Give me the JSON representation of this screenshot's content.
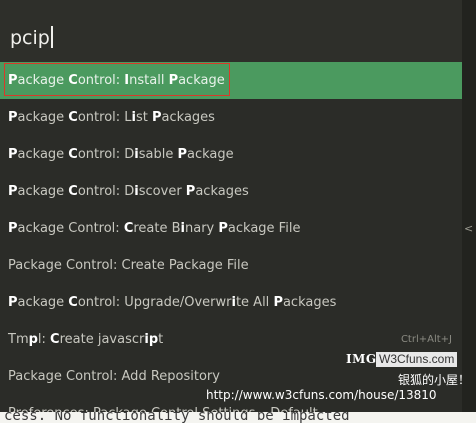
{
  "search": {
    "query": "pcip"
  },
  "items": [
    {
      "segments": [
        {
          "t": "P",
          "h": true
        },
        {
          "t": "ackage ",
          "h": false
        },
        {
          "t": "C",
          "h": true
        },
        {
          "t": "ontrol: ",
          "h": false
        },
        {
          "t": "I",
          "h": true
        },
        {
          "t": "nstall ",
          "h": false
        },
        {
          "t": "P",
          "h": true
        },
        {
          "t": "ackage",
          "h": false
        }
      ]
    },
    {
      "segments": [
        {
          "t": "P",
          "h": true
        },
        {
          "t": "ackage ",
          "h": false
        },
        {
          "t": "C",
          "h": true
        },
        {
          "t": "ontrol: L",
          "h": false
        },
        {
          "t": "i",
          "h": true
        },
        {
          "t": "st ",
          "h": false
        },
        {
          "t": "P",
          "h": true
        },
        {
          "t": "ackages",
          "h": false
        }
      ]
    },
    {
      "segments": [
        {
          "t": "P",
          "h": true
        },
        {
          "t": "ackage ",
          "h": false
        },
        {
          "t": "C",
          "h": true
        },
        {
          "t": "ontrol: D",
          "h": false
        },
        {
          "t": "i",
          "h": true
        },
        {
          "t": "sable ",
          "h": false
        },
        {
          "t": "P",
          "h": true
        },
        {
          "t": "ackage",
          "h": false
        }
      ]
    },
    {
      "segments": [
        {
          "t": "P",
          "h": true
        },
        {
          "t": "ackage ",
          "h": false
        },
        {
          "t": "C",
          "h": true
        },
        {
          "t": "ontrol: D",
          "h": false
        },
        {
          "t": "i",
          "h": true
        },
        {
          "t": "scover ",
          "h": false
        },
        {
          "t": "P",
          "h": true
        },
        {
          "t": "ackages",
          "h": false
        }
      ]
    },
    {
      "segments": [
        {
          "t": "P",
          "h": true
        },
        {
          "t": "ackage Control: ",
          "h": false
        },
        {
          "t": "C",
          "h": true
        },
        {
          "t": "reate B",
          "h": false
        },
        {
          "t": "i",
          "h": true
        },
        {
          "t": "nary ",
          "h": false
        },
        {
          "t": "P",
          "h": true
        },
        {
          "t": "ackage File",
          "h": false
        }
      ]
    },
    {
      "segments": [
        {
          "t": "Package Control: Create Package File",
          "h": false
        }
      ]
    },
    {
      "segments": [
        {
          "t": "P",
          "h": true
        },
        {
          "t": "ackage ",
          "h": false
        },
        {
          "t": "C",
          "h": true
        },
        {
          "t": "ontrol: Upgrade/Overwr",
          "h": false
        },
        {
          "t": "i",
          "h": true
        },
        {
          "t": "te All ",
          "h": false
        },
        {
          "t": "P",
          "h": true
        },
        {
          "t": "ackages",
          "h": false
        }
      ]
    },
    {
      "segments": [
        {
          "t": "Tm",
          "h": false
        },
        {
          "t": "p",
          "h": true
        },
        {
          "t": "l: ",
          "h": false
        },
        {
          "t": "C",
          "h": true
        },
        {
          "t": "reate javascr",
          "h": false
        },
        {
          "t": "ip",
          "h": true
        },
        {
          "t": "t",
          "h": false
        }
      ],
      "shortcut": "Ctrl+Alt+J"
    },
    {
      "segments": [
        {
          "t": "Package Control: Add Repository",
          "h": false
        }
      ]
    }
  ],
  "partial_item": "Preferences: Package Control Settings – Default",
  "editor_fragment": "cess. No functionality should be impacted",
  "watermark": {
    "img_label": "IMG",
    "site": "W3Cfuns.com",
    "caption": "银狐的小屋！",
    "url": "http://www.w3cfuns.com/house/13810"
  },
  "right_strip_chevron": "<"
}
